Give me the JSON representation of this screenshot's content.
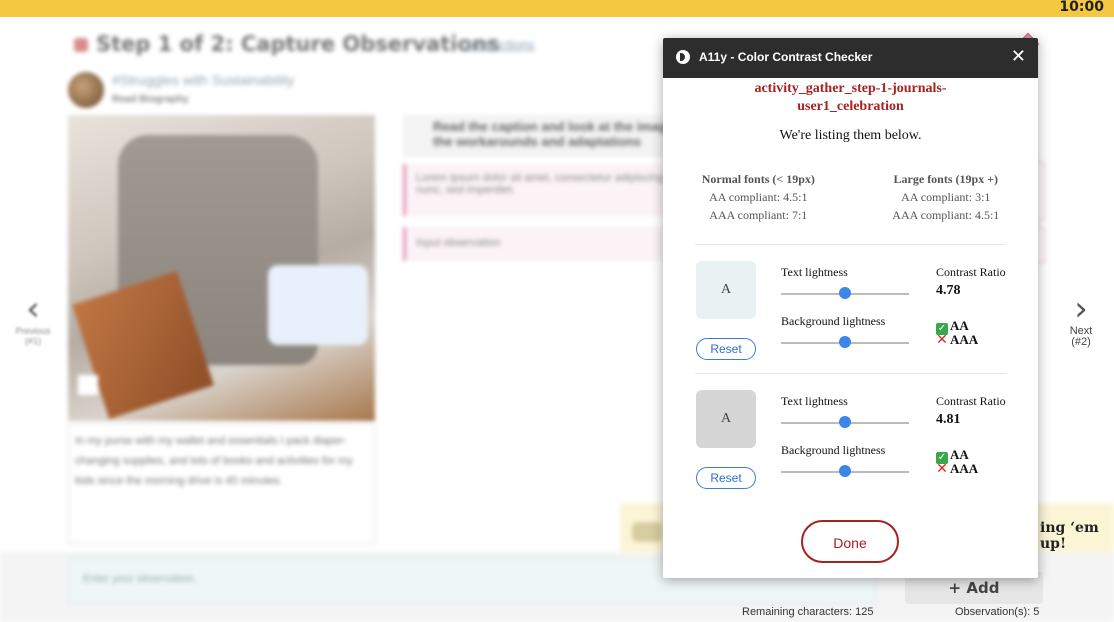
{
  "status": {
    "clock": "10:00"
  },
  "background": {
    "step_title": "Step 1 of 2: Capture Observations",
    "instructions_link": "Instructions",
    "post_title": "#Struggles with Sustainability",
    "post_subtitle": "Read Biography",
    "caption": "In my purse with my wallet and essentials I pack diaper-changing supplies, and lots of books and activities for my kids since the morning drive is 45 minutes.",
    "prompt": "Read the caption and look at the image... the workarounds and adaptations",
    "observation_1": "Lorem ipsum dolor sit amet, consectetur adipiscing nunc, sed imperdiet.",
    "observation_2": "Input observation",
    "observation_input_placeholder": "Enter your observation.",
    "banner_text": "ing ‘em up!",
    "add_button": "Add",
    "remaining_characters": "Remaining characters: 125",
    "observation_count": "Observation(s): 5",
    "nav_prev_label": "Previous",
    "nav_prev_sub": "(#1)",
    "nav_next_label": "Next",
    "nav_next_sub": "(#2)"
  },
  "dialog": {
    "title": "A11y - Color Contrast Checker",
    "element_id_line1": "activity_gather_step-1-journals-",
    "element_id_line2": "user1_celebration",
    "description": "We're listing them below.",
    "normal_fonts": {
      "header": "Normal fonts (< 19px)",
      "aa": "AA compliant: 4.5:1",
      "aaa": "AAA compliant: 7:1"
    },
    "large_fonts": {
      "header": "Large fonts (19px +)",
      "aa": "AA compliant: 3:1",
      "aaa": "AAA compliant: 4.5:1"
    },
    "rows": [
      {
        "swatch_text": "A",
        "swatch_bg": "#e9f1f3",
        "swatch_fg": "#444444",
        "reset_label": "Reset",
        "text_lightness_label": "Text lightness",
        "text_lightness": 0.5,
        "bg_lightness_label": "Background lightness",
        "bg_lightness": 0.5,
        "contrast_label": "Contrast Ratio",
        "contrast_value": "4.78",
        "aa_label": "AA",
        "aa_pass": true,
        "aaa_label": "AAA",
        "aaa_pass": false
      },
      {
        "swatch_text": "A",
        "swatch_bg": "#d6d6d6",
        "swatch_fg": "#444444",
        "reset_label": "Reset",
        "text_lightness_label": "Text lightness",
        "text_lightness": 0.5,
        "bg_lightness_label": "Background lightness",
        "bg_lightness": 0.5,
        "contrast_label": "Contrast Ratio",
        "contrast_value": "4.81",
        "aa_label": "AA",
        "aa_pass": true,
        "aaa_label": "AAA",
        "aaa_pass": false
      }
    ],
    "done_label": "Done"
  },
  "colors": {
    "topbar": "#f5c842",
    "accent_red": "#a52222",
    "slider_blue": "#3c86e8"
  },
  "icons": {
    "close": "close-icon",
    "logo": "a11y-logo-icon",
    "prev": "chevron-left-icon",
    "next": "chevron-right-icon",
    "add": "plus-icon"
  }
}
